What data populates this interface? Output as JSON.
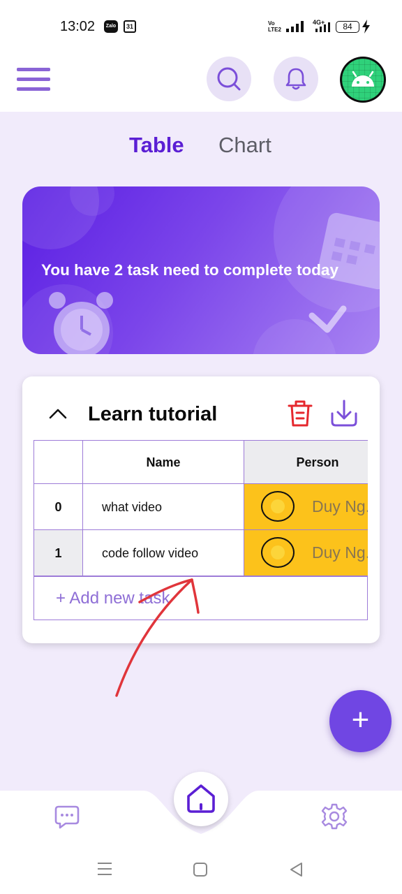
{
  "status_bar": {
    "time": "13:02",
    "zalo_label": "Zalo",
    "calendar_day": "31",
    "volte_label": "Vo LTE2",
    "network_label": "4G+",
    "battery": "84"
  },
  "tabs": [
    {
      "label": "Table",
      "active": true
    },
    {
      "label": "Chart",
      "active": false
    }
  ],
  "banner": {
    "message": "You have 2 task need to complete today"
  },
  "task_group": {
    "title": "Learn tutorial",
    "columns": [
      "",
      "Name",
      "Person"
    ],
    "rows": [
      {
        "index": "0",
        "name": "what video",
        "person": "Duy Ng..."
      },
      {
        "index": "1",
        "name": "code follow video",
        "person": "Duy Ng..."
      }
    ],
    "add_label": "+ Add new task"
  },
  "fab": {
    "label": "+"
  },
  "icons": {
    "menu": "hamburger-icon",
    "search": "search-icon",
    "notifications": "bell-icon",
    "profile": "android-avatar",
    "collapse": "chevron-up-icon",
    "delete": "trash-icon",
    "download": "download-icon",
    "home": "home-icon",
    "chat": "chat-icon",
    "settings": "gear-icon"
  },
  "colors": {
    "primary": "#5b1fd4",
    "accent": "#7046e3",
    "person_cell": "#fcc21b",
    "delete": "#e5282e",
    "annotation": "#e0353b"
  }
}
